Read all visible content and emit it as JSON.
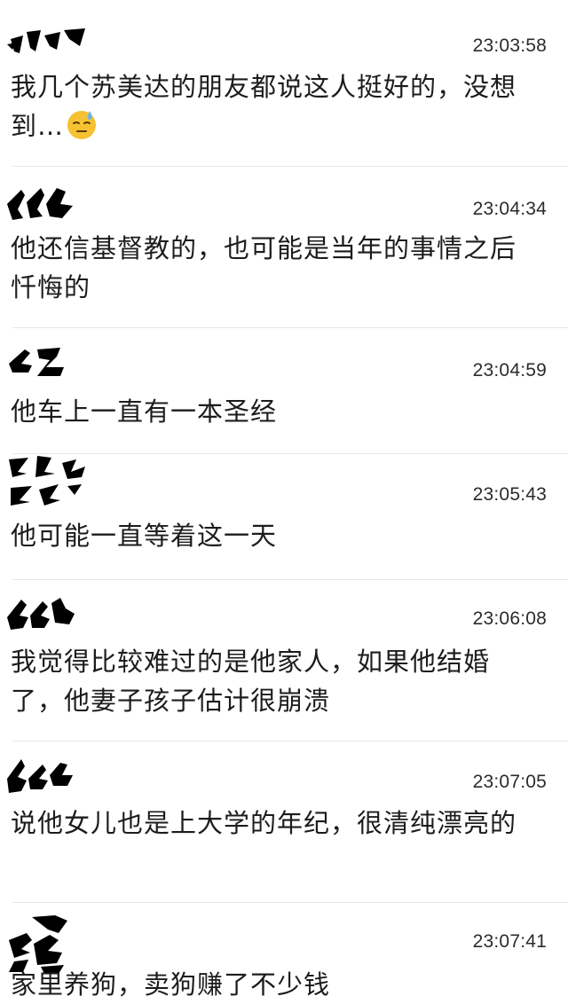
{
  "messages": [
    {
      "time": "23:03:58",
      "text": "我几个苏美达的朋友都说这人挺好的，没想到…",
      "emoji": "downcast-sweat-emoji"
    },
    {
      "time": "23:04:34",
      "text": "他还信基督教的，也可能是当年的事情之后忏悔的"
    },
    {
      "time": "23:04:59",
      "text": "他车上一直有一本圣经"
    },
    {
      "time": "23:05:43",
      "text": "他可能一直等着这一天"
    },
    {
      "time": "23:06:08",
      "text": "我觉得比较难过的是他家人，如果他结婚了，他妻子孩子估计很崩溃"
    },
    {
      "time": "23:07:05",
      "text": "说他女儿也是上大学的年纪，很清纯漂亮的"
    },
    {
      "time": "23:07:41",
      "text": "家里养狗，卖狗赚了不少钱"
    }
  ],
  "colors": {
    "background": "#ffffff",
    "text": "#1c1c1c",
    "divider": "#e6e6e6",
    "redaction": "#000000"
  }
}
